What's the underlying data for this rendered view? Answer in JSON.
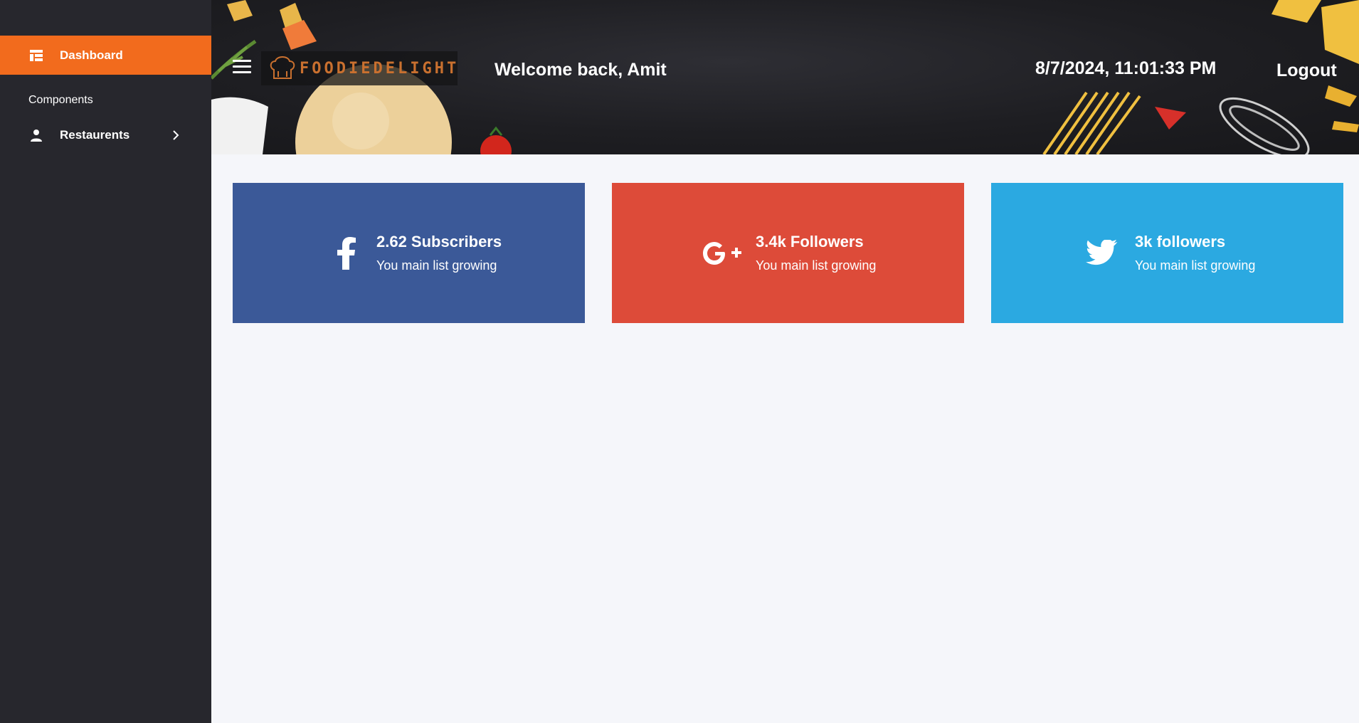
{
  "sidebar": {
    "active_item": {
      "label": "Dashboard",
      "icon": "dashboard-icon"
    },
    "section_label": "Components",
    "items": [
      {
        "label": "Restaurents",
        "icon": "user-icon"
      }
    ]
  },
  "header": {
    "logo_text": "FOODIEDELIGHT",
    "welcome": "Welcome back, Amit",
    "datetime": "8/7/2024, 11:01:33 PM",
    "logout": "Logout"
  },
  "cards": [
    {
      "icon": "facebook-icon",
      "title": "2.62 Subscribers",
      "subtitle": "You main list growing",
      "color": "#3b5998"
    },
    {
      "icon": "google-plus-icon",
      "title": "3.4k Followers",
      "subtitle": "You main list growing",
      "color": "#dd4b39"
    },
    {
      "icon": "twitter-icon",
      "title": "3k followers",
      "subtitle": "You main list growing",
      "color": "#2ba9e1"
    }
  ],
  "colors": {
    "accent": "#f26b1d",
    "sidebar_bg": "#27272d",
    "main_bg": "#f5f6fa"
  }
}
